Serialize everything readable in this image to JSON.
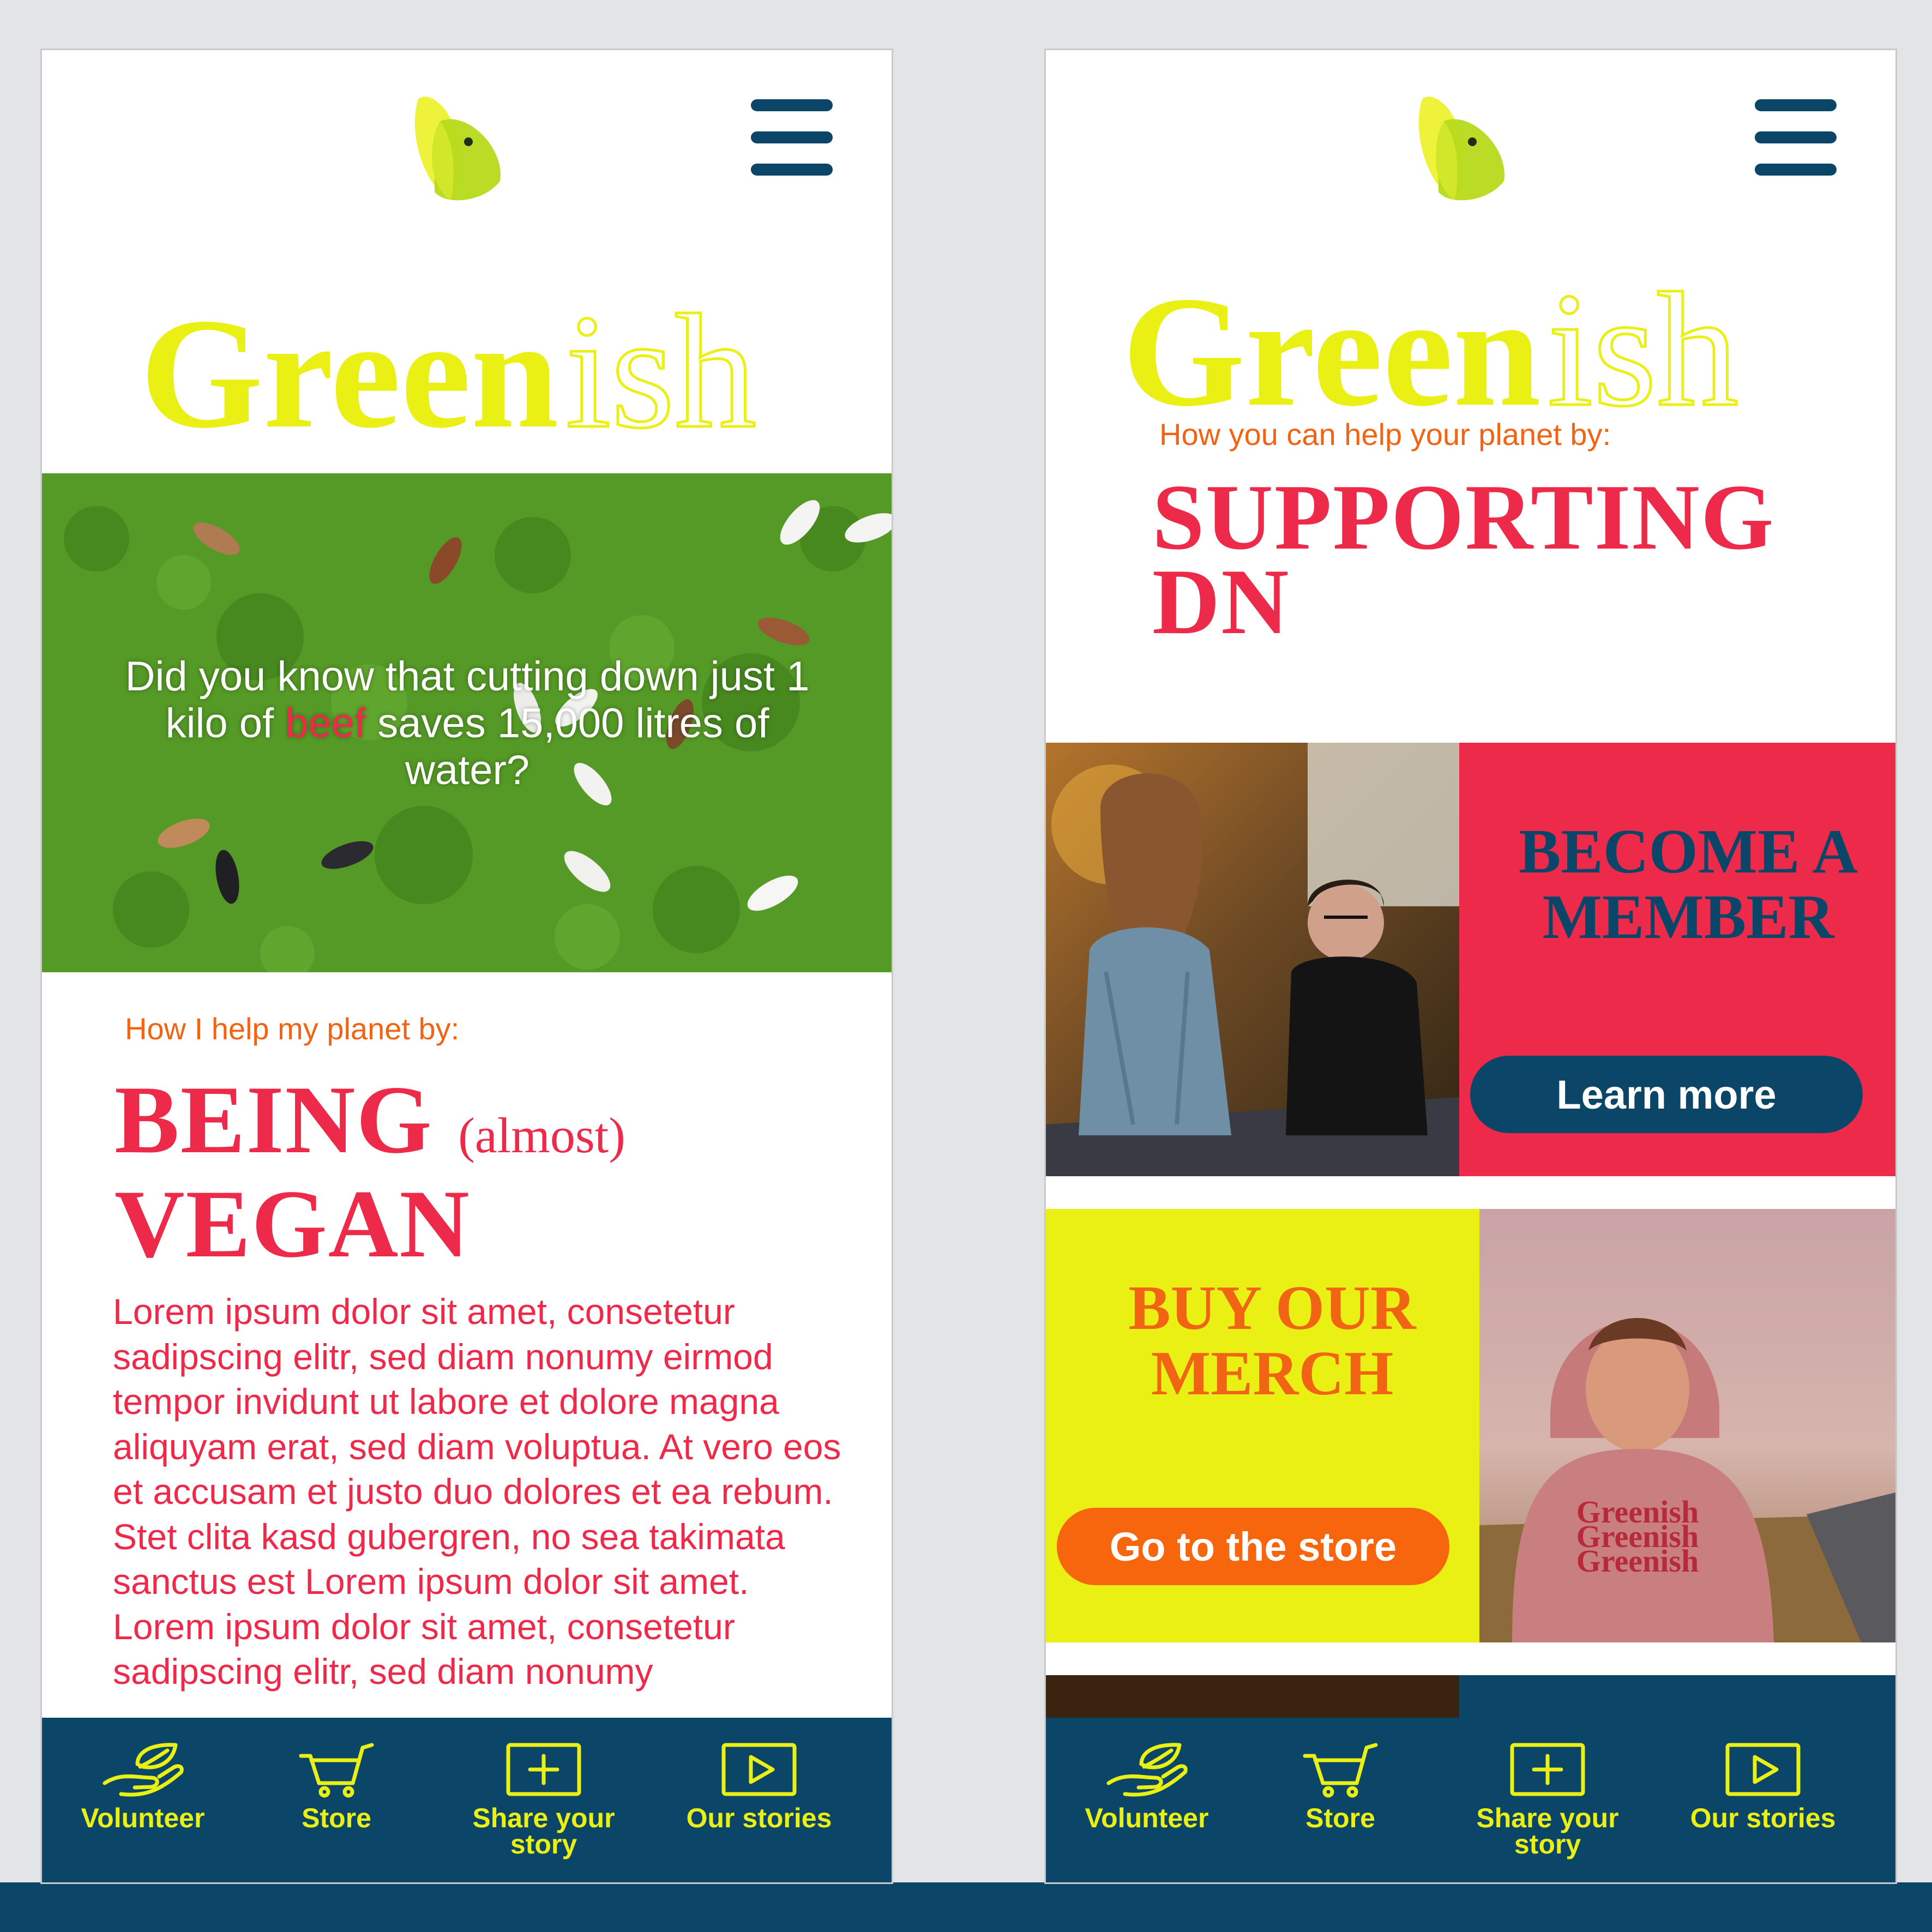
{
  "brand": {
    "name_part1": "Green",
    "name_part2": "ish",
    "yellow": "#eaf014",
    "navy": "#0b4668",
    "red": "#ee2a4a",
    "orange": "#f06414"
  },
  "left_screen": {
    "hero_text": {
      "before": "Did you know that cutting down just 1 kilo of ",
      "highlight": "beef",
      "after": " saves 15,000 litres of water?"
    },
    "kicker": "How I help my planet by:",
    "title_line1": "BEING",
    "title_aside": "(almost)",
    "title_line2": "VEGAN",
    "body": "Lorem ipsum dolor sit amet, consetetur sadipscing elitr, sed diam nonumy eirmod tempor invidunt ut labore et dolore magna aliquyam erat, sed diam voluptua. At vero eos et accusam et justo duo dolores et ea rebum. Stet clita kasd gubergren, no sea takimata sanctus est Lorem ipsum dolor sit amet. Lorem ipsum dolor sit amet, consetetur sadipscing elitr, sed diam nonumy"
  },
  "right_screen": {
    "kicker": "How you can help your planet by:",
    "title_line1": "SUPPORTING",
    "title_line2": "DN",
    "member_card": {
      "title_line1": "BECOME A",
      "title_line2": "MEMBER",
      "button": "Learn more"
    },
    "merch_card": {
      "title_line1": "BUY OUR",
      "title_line2": "MERCH",
      "button": "Go to the store",
      "hoodie_print": "Greenish"
    }
  },
  "tabbar": {
    "items": [
      {
        "label": "Volunteer",
        "icon": "hand-leaf-icon"
      },
      {
        "label": "Store",
        "icon": "cart-icon"
      },
      {
        "label": "Share your\nstory",
        "icon": "plus-square-icon"
      },
      {
        "label": "Our stories",
        "icon": "play-icon"
      }
    ]
  }
}
